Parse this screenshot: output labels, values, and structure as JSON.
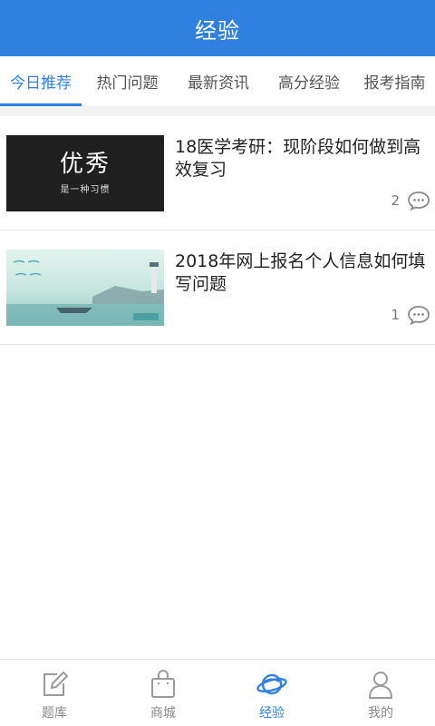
{
  "header": {
    "title": "经验"
  },
  "tabs": [
    {
      "label": "今日推荐",
      "active": true
    },
    {
      "label": "热门问题",
      "active": false
    },
    {
      "label": "最新资讯",
      "active": false
    },
    {
      "label": "高分经验",
      "active": false
    },
    {
      "label": "报考指南",
      "active": false
    }
  ],
  "articles": [
    {
      "title": "18医学考研：现阶段如何做到高效复习",
      "comment_count": "2",
      "thumb_text_big": "优秀",
      "thumb_text_small": "是一种习惯"
    },
    {
      "title": "2018年网上报名个人信息如何填写问题",
      "comment_count": "1"
    }
  ],
  "bottom_nav": [
    {
      "label": "题库",
      "icon": "edit-icon",
      "active": false
    },
    {
      "label": "商城",
      "icon": "shopping-bag-icon",
      "active": false
    },
    {
      "label": "经验",
      "icon": "planet-icon",
      "active": true
    },
    {
      "label": "我的",
      "icon": "user-icon",
      "active": false
    }
  ],
  "colors": {
    "primary": "#2f80df",
    "inactive": "#8a8a8a"
  }
}
